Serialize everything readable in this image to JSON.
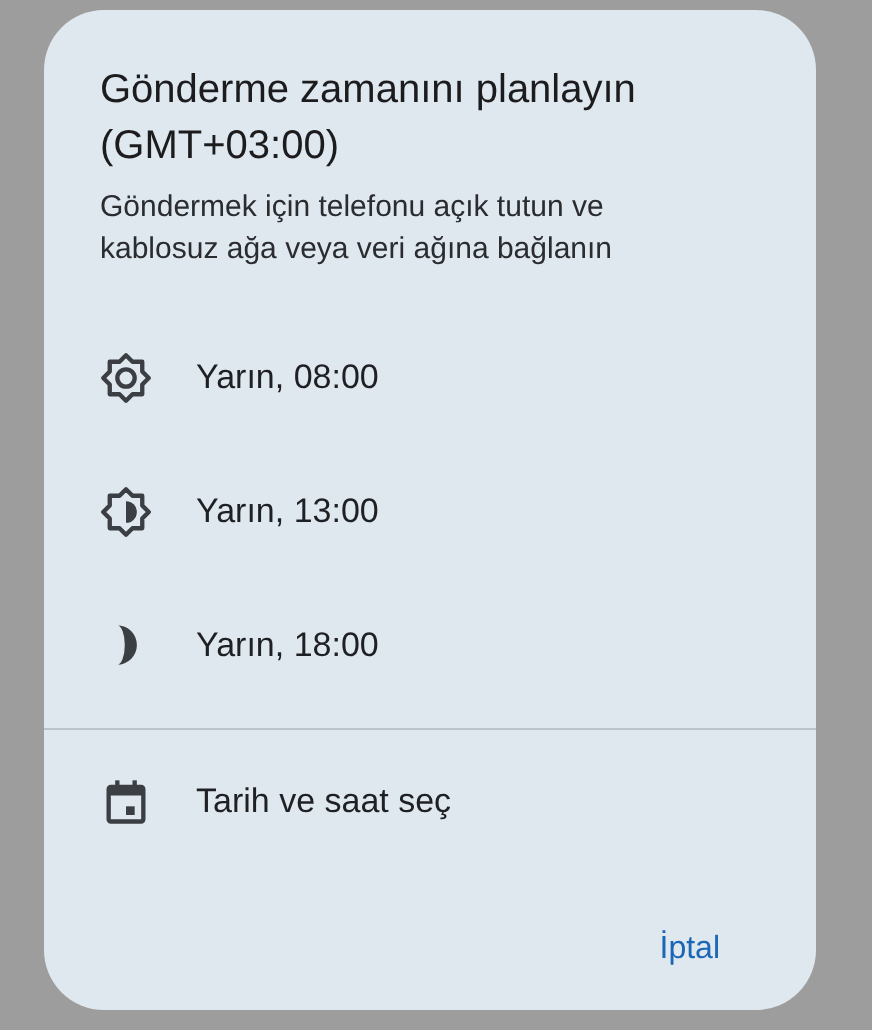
{
  "dialog": {
    "title": "Gönderme zamanını planlayın (GMT+03:00)",
    "subtitle": "Göndermek için telefonu açık tutun ve kablosuz ağa veya veri ağına bağlanın",
    "options": [
      {
        "kind": "sun",
        "label": "Yarın, 08:00"
      },
      {
        "kind": "half-sun",
        "label": "Yarın, 13:00"
      },
      {
        "kind": "moon",
        "label": "Yarın, 18:00"
      }
    ],
    "custom_option": {
      "label": "Tarih ve saat seç"
    },
    "cancel_button": "İptal"
  }
}
